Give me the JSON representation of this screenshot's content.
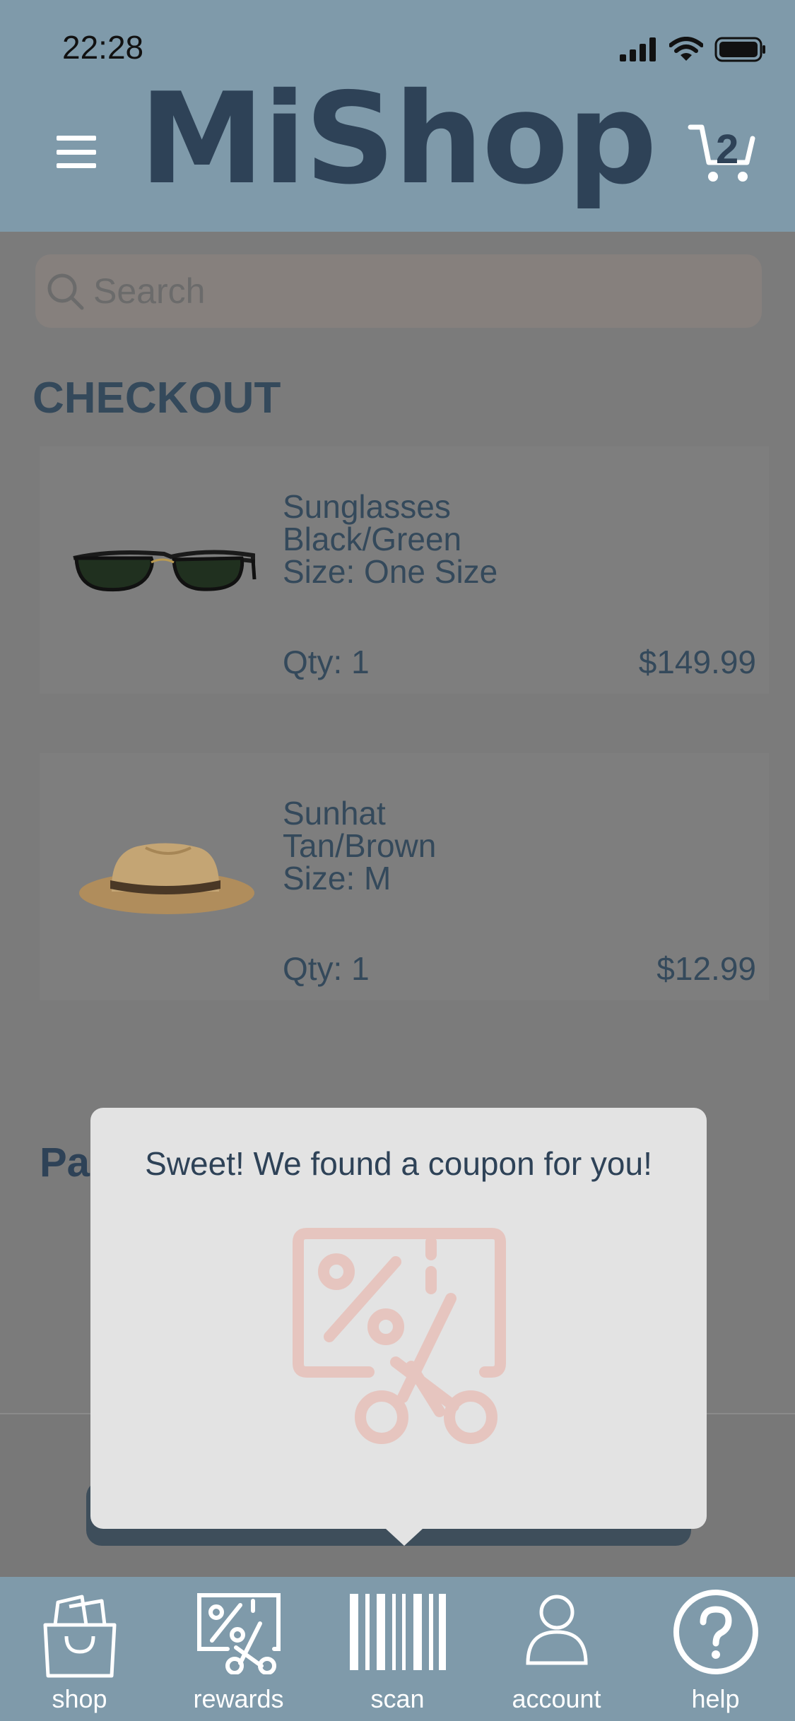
{
  "status_bar": {
    "time": "22:28"
  },
  "header": {
    "brand": "MiShop",
    "cart_count": "2"
  },
  "search": {
    "placeholder": "Search"
  },
  "checkout": {
    "title": "CHECKOUT",
    "items": [
      {
        "name": "Sunglasses",
        "color": "Black/Green",
        "size": "Size: One Size",
        "qty": "Qty: 1",
        "price": "$149.99",
        "image": "sunglasses"
      },
      {
        "name": "Sunhat",
        "color": "Tan/Brown",
        "size": "Size: M",
        "qty": "Qty: 1",
        "price": "$12.99",
        "image": "sunhat"
      }
    ]
  },
  "payment_title_partial": "Pa",
  "popup": {
    "message": "Sweet! We found a coupon for you!",
    "icon": "coupon-scissors-icon",
    "icon_color": "#e6c5bf"
  },
  "tabbar": {
    "tabs": [
      {
        "label": "shop",
        "icon": "shopping-bag-icon"
      },
      {
        "label": "rewards",
        "icon": "coupon-icon"
      },
      {
        "label": "scan",
        "icon": "barcode-icon"
      },
      {
        "label": "account",
        "icon": "user-icon"
      },
      {
        "label": "help",
        "icon": "help-icon"
      }
    ]
  },
  "colors": {
    "header_bg": "#7f9aaa",
    "brand": "#2e4257",
    "overlay_bg": "#7b7b7b",
    "popup_bg": "#e3e3e3"
  }
}
